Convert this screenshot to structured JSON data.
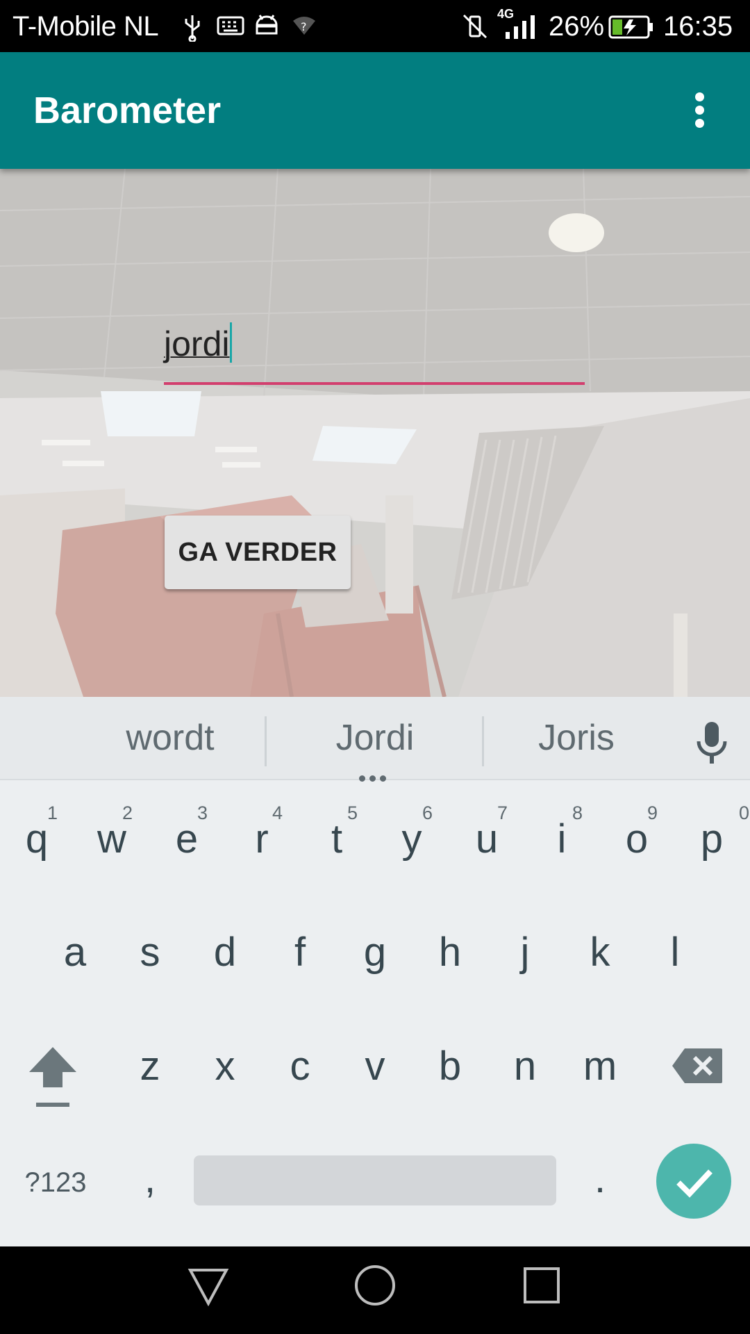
{
  "status_bar": {
    "carrier": "T-Mobile  NL",
    "network": "4G",
    "battery_percent": "26%",
    "time": "16:35",
    "icons": [
      "usb-icon",
      "keyboard-icon",
      "android-icon",
      "wifi-unknown-icon",
      "vibrate-off-icon",
      "signal-icon",
      "battery-charging-icon"
    ]
  },
  "app_bar": {
    "title": "Barometer",
    "overflow_icon": "more-vert-icon"
  },
  "form": {
    "name_value": "jordi",
    "continue_label": "GA VERDER"
  },
  "keyboard": {
    "suggestions": [
      "wordt",
      "Jordi",
      "Joris"
    ],
    "row1": [
      {
        "key": "q",
        "hint": "1"
      },
      {
        "key": "w",
        "hint": "2"
      },
      {
        "key": "e",
        "hint": "3"
      },
      {
        "key": "r",
        "hint": "4"
      },
      {
        "key": "t",
        "hint": "5"
      },
      {
        "key": "y",
        "hint": "6"
      },
      {
        "key": "u",
        "hint": "7"
      },
      {
        "key": "i",
        "hint": "8"
      },
      {
        "key": "o",
        "hint": "9"
      },
      {
        "key": "p",
        "hint": "0"
      }
    ],
    "row2": [
      "a",
      "s",
      "d",
      "f",
      "g",
      "h",
      "j",
      "k",
      "l"
    ],
    "row3": [
      "z",
      "x",
      "c",
      "v",
      "b",
      "n",
      "m"
    ],
    "symbols_label": "?123",
    "comma": ",",
    "period": ".",
    "accent_color": "#4db6ac"
  },
  "colors": {
    "app_bar": "#027e80",
    "field_underline": "#d23f6e"
  }
}
